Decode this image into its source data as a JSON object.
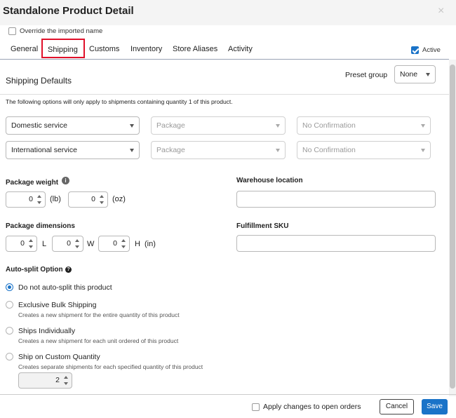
{
  "dialog": {
    "title": "Standalone Product Detail",
    "close_label": "×"
  },
  "override": {
    "label": "Override the imported name",
    "checked": false
  },
  "tabs": [
    {
      "label": "General"
    },
    {
      "label": "Shipping"
    },
    {
      "label": "Customs"
    },
    {
      "label": "Inventory"
    },
    {
      "label": "Store Aliases"
    },
    {
      "label": "Activity"
    }
  ],
  "active_toggle": {
    "label": "Active",
    "checked": true
  },
  "shipping_defaults": {
    "title": "Shipping Defaults",
    "preset_label": "Preset group",
    "preset_value": "None",
    "note": "The following options will only apply to shipments containing quantity 1 of this product."
  },
  "services": {
    "domestic": {
      "service": "Domestic service",
      "package": "Package",
      "confirmation": "No Confirmation"
    },
    "international": {
      "service": "International service",
      "package": "Package",
      "confirmation": "No Confirmation"
    }
  },
  "weight": {
    "label": "Package weight",
    "lb_value": "0",
    "lb_unit": "(lb)",
    "oz_value": "0",
    "oz_unit": "(oz)"
  },
  "warehouse": {
    "label": "Warehouse location",
    "value": ""
  },
  "dimensions": {
    "label": "Package dimensions",
    "l_value": "0",
    "l_unit": "L",
    "w_value": "0",
    "w_unit": "W",
    "h_value": "0",
    "h_unit": "H",
    "in_unit": "(in)"
  },
  "fulfillment": {
    "label": "Fulfillment SKU",
    "value": ""
  },
  "autosplit": {
    "label": "Auto-split Option",
    "options": [
      {
        "label": "Do not auto-split this product",
        "desc": "",
        "selected": true
      },
      {
        "label": "Exclusive Bulk Shipping",
        "desc": "Creates a new shipment for the entire quantity of this product",
        "selected": false
      },
      {
        "label": "Ships Individually",
        "desc": "Creates a new shipment for each unit ordered of this product",
        "selected": false
      },
      {
        "label": "Ship on Custom Quantity",
        "desc": "Creates separate shipments for each specified quantity of this product",
        "selected": false
      }
    ],
    "custom_quantity": "2"
  },
  "footer": {
    "apply_label": "Apply changes to open orders",
    "cancel_label": "Cancel",
    "save_label": "Save"
  },
  "colors": {
    "accent": "#1a73c8",
    "highlight": "#e0102a"
  }
}
